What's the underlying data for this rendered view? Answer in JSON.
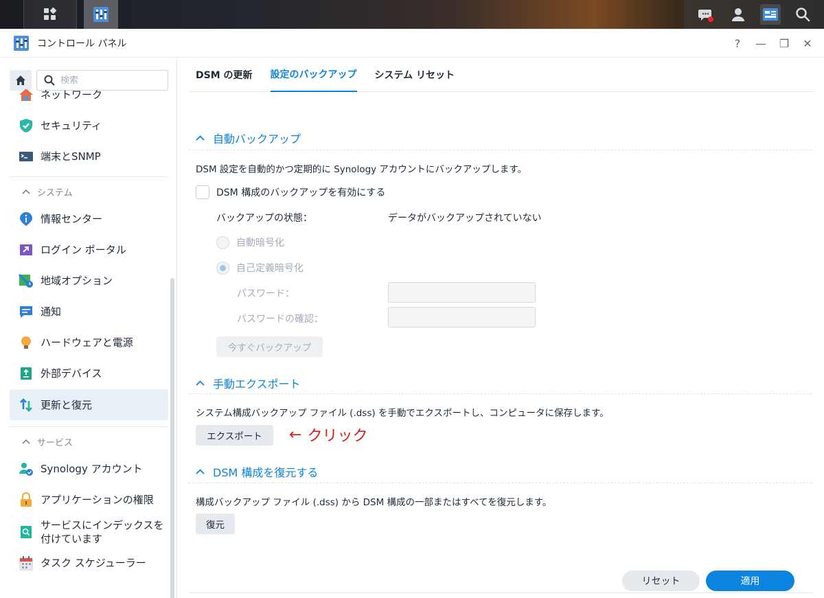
{
  "window": {
    "title": "コントロール パネル",
    "help": "?",
    "minimize": "—",
    "restore": "❐",
    "close": "✕"
  },
  "sidebar": {
    "search_placeholder": "検索",
    "items": [
      {
        "label": "ネットワーク",
        "icon": "network-icon"
      },
      {
        "label": "セキュリティ",
        "icon": "shield-icon"
      },
      {
        "label": "端末とSNMP",
        "icon": "terminal-icon"
      },
      {
        "label": "情報センター",
        "icon": "info-icon"
      },
      {
        "label": "ログイン ポータル",
        "icon": "login-portal-icon"
      },
      {
        "label": "地域オプション",
        "icon": "regional-options-icon"
      },
      {
        "label": "通知",
        "icon": "notification-icon"
      },
      {
        "label": "ハードウェアと電源",
        "icon": "hardware-power-icon"
      },
      {
        "label": "外部デバイス",
        "icon": "external-device-icon"
      },
      {
        "label": "更新と復元",
        "icon": "update-restore-icon"
      },
      {
        "label": "Synology アカウント",
        "icon": "synology-account-icon"
      },
      {
        "label": "アプリケーションの権限",
        "icon": "lock-icon"
      },
      {
        "label_line1": "サービスにインデックスを",
        "label_line2": "付けています",
        "icon": "indexing-icon"
      },
      {
        "label": "タスク スケジューラー",
        "icon": "calendar-icon"
      }
    ],
    "sections": {
      "system": "システム",
      "services": "サービス"
    }
  },
  "tabs": [
    "DSM の更新",
    "設定のバックアップ",
    "システム リセット"
  ],
  "auto_backup": {
    "heading": "自動バックアップ",
    "description": "DSM 設定を自動的かつ定期的に Synology アカウントにバックアップします。",
    "enable_label": "DSM 構成のバックアップを有効にする",
    "status_label": "バックアップの状態：",
    "status_value": "データがバックアップされていない",
    "auto_encrypt": "自動暗号化",
    "custom_encrypt": "自己定義暗号化",
    "password_label": "パスワード：",
    "password_confirm_label": "パスワードの確認：",
    "backup_now": "今すぐバックアップ"
  },
  "manual_export": {
    "heading": "手動エクスポート",
    "description": "システム構成バックアップ ファイル (.dss) を手動でエクスポートし、コンピュータに保存します。",
    "export_button": "エクスポート",
    "annotation_arrow": "←",
    "annotation_text": "クリック"
  },
  "restore": {
    "heading": "DSM 構成を復元する",
    "description": "構成バックアップ ファイル (.dss) から DSM 構成の一部またはすべてを復元します。",
    "restore_button": "復元"
  },
  "footer": {
    "reset": "リセット",
    "apply": "適用"
  },
  "colors": {
    "accent": "#0b84e0",
    "annotation": "#d41f1f"
  }
}
